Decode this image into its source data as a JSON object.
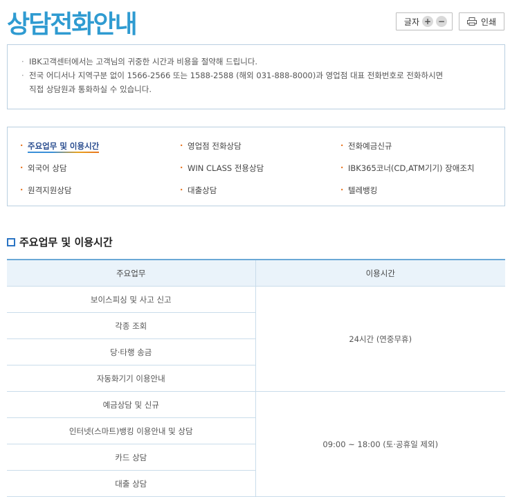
{
  "header": {
    "title": "상담전화안내",
    "font_size_label": "글자",
    "increase_symbol": "+",
    "decrease_symbol": "−",
    "print_label": "인쇄",
    "print_icon": "printer-icon"
  },
  "info": {
    "line1": "IBK고객센터에서는 고객님의 귀중한 시간과 비용을 절약해 드립니다.",
    "line2a": "전국 어디서나 지역구분 없이 1566-2566 또는 1588-2588 (해외 031-888-8000)과 영업점 대표 전화번호로 전화하시면",
    "line2b": "직접 상담원과 통화하실 수 있습니다."
  },
  "links": [
    "주요업무 및 이용시간",
    "영업점 전화상담",
    "전화예금신규",
    "외국어 상담",
    "WIN CLASS 전용상담",
    "IBK365코너(CD,ATM기기) 장애조치",
    "원격지원상담",
    "대출상담",
    "텔레뱅킹"
  ],
  "section": {
    "title": "주요업무 및 이용시간"
  },
  "table": {
    "headers": [
      "주요업무",
      "이용시간"
    ],
    "group1": {
      "tasks": [
        "보이스피싱 및 사고 신고",
        "각종 조회",
        "당·타행 송금",
        "자동화기기 이용안내"
      ],
      "time": "24시간 (연중무휴)"
    },
    "group2": {
      "tasks": [
        "예금상담 및 신규",
        "인터넷(스마트)뱅킹 이용안내 및 상담",
        "카드 상담",
        "대출 상담"
      ],
      "time": "09:00 ~ 18:00 (토·공휴일 제외)"
    }
  },
  "colors": {
    "title": "#2f9bd1",
    "border": "#b9cfe0",
    "table_header_bg": "#eaf3fa",
    "bullet_accent": "#e8731e",
    "active_link": "#2a4d8f"
  }
}
